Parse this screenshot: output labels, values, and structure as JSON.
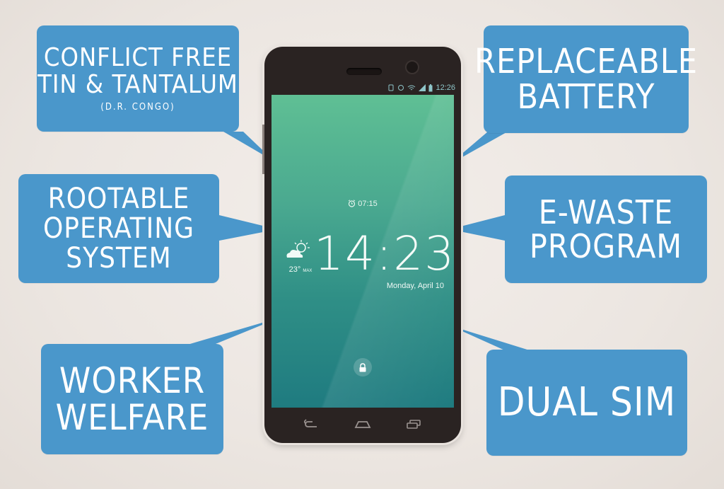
{
  "bubbles": {
    "conflict": {
      "lines": [
        "CONFLICT FREE",
        "TIN & TANTALUM"
      ],
      "sub": "(D.R. CONGO)"
    },
    "battery": {
      "lines": [
        "REPLACEABLE",
        "BATTERY"
      ]
    },
    "rootable": {
      "lines": [
        "ROOTABLE",
        "OPERATING",
        "SYSTEM"
      ]
    },
    "ewaste": {
      "lines": [
        "E-WASTE",
        "PROGRAM"
      ]
    },
    "worker": {
      "lines": [
        "WORKER",
        "WELFARE"
      ]
    },
    "dualsim": {
      "lines": [
        "DUAL SIM"
      ]
    }
  },
  "phone": {
    "status_time": "12:26",
    "alarm_time": "07:15",
    "clock": "14:23",
    "date": "Monday, April 10",
    "weather": {
      "temp": "23°",
      "label": "MAX",
      "icon": "partly-cloudy-icon"
    }
  },
  "colors": {
    "bubble": "#4a97cb",
    "phone_body": "#2a2322",
    "screen_top": "#5fbf94",
    "screen_bottom": "#1f7b80"
  }
}
